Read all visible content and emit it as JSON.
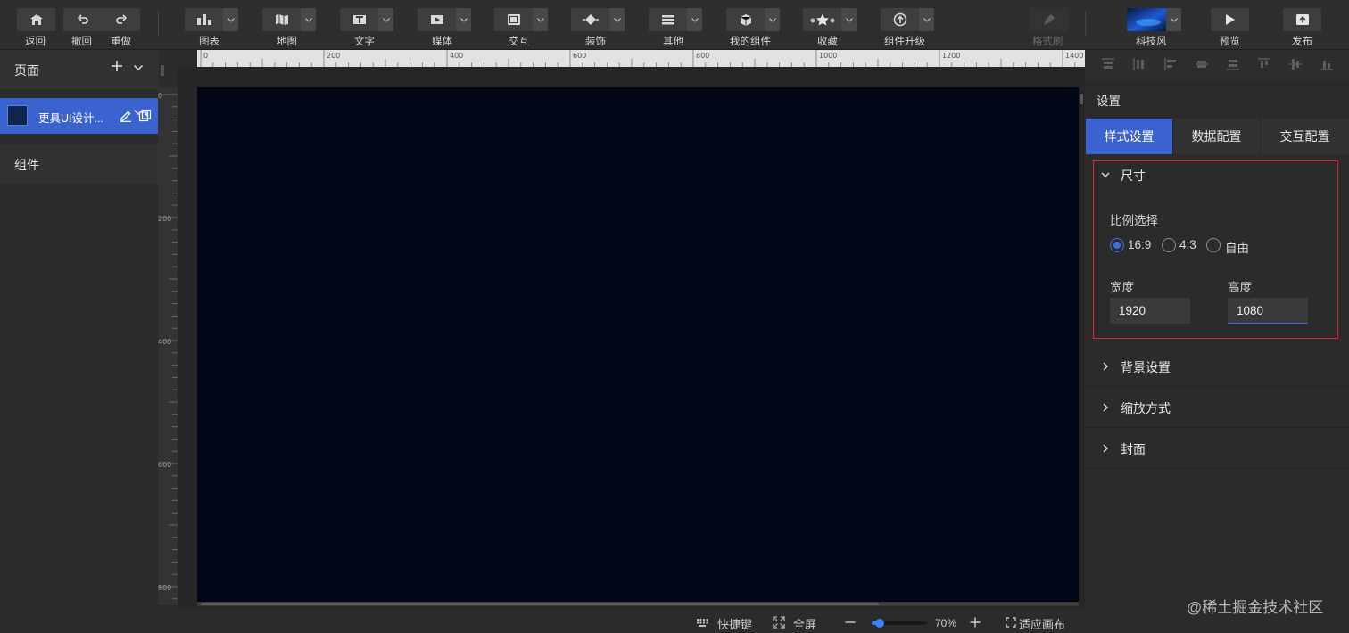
{
  "toolbar": {
    "back": "返回",
    "undo": "撤回",
    "redo": "重做",
    "chart": "图表",
    "map": "地图",
    "text": "文字",
    "media": "媒体",
    "interaction": "交互",
    "decoration": "装饰",
    "other": "其他",
    "my_components": "我的组件",
    "favorites": "收藏",
    "upgrade": "组件升级",
    "format_brush": "格式刷",
    "theme": "科技风",
    "preview": "预览",
    "publish": "发布"
  },
  "left_panel": {
    "pages_title": "页面",
    "page_name": "更具UI设计...",
    "components_title": "组件"
  },
  "ruler": {
    "top_ticks": [
      "0",
      "200",
      "400",
      "600",
      "800",
      "1000",
      "1200",
      "1400"
    ],
    "left_ticks": [
      "0",
      "200",
      "400",
      "600",
      "800"
    ]
  },
  "status_bar": {
    "shortcuts": "快捷键",
    "fullscreen": "全屏",
    "zoom_value": "70%",
    "fit_canvas": "适应画布",
    "zoom_percent": 0.1
  },
  "right_panel": {
    "title": "设置",
    "tabs": [
      "样式设置",
      "数据配置",
      "交互配置"
    ],
    "size_section": {
      "title": "尺寸",
      "ratio_label": "比例选择",
      "ratios": [
        "16:9",
        "4:3",
        "自由"
      ],
      "selected_ratio": "16:9",
      "width_label": "宽度",
      "width_value": "1920",
      "height_label": "高度",
      "height_value": "1080"
    },
    "sections": [
      "背景设置",
      "缩放方式",
      "封面"
    ]
  },
  "watermark": "@稀土掘金技术社区",
  "colors": {
    "accent": "#3a63cf",
    "canvas": "#020718",
    "highlight_border": "#e0242c"
  }
}
